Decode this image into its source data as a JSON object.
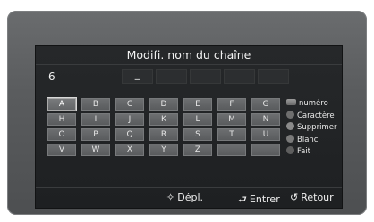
{
  "dialog": {
    "title": "Modifi. nom du chaîne",
    "channel_number": "6",
    "name_slots": [
      "_",
      "",
      "",
      "",
      ""
    ]
  },
  "keyboard": {
    "rows": [
      [
        "A",
        "B",
        "C",
        "D",
        "E",
        "F",
        "G"
      ],
      [
        "H",
        "I",
        "J",
        "K",
        "L",
        "M",
        "N"
      ],
      [
        "O",
        "P",
        "Q",
        "R",
        "S",
        "T",
        "U"
      ],
      [
        "V",
        "W",
        "X",
        "Y",
        "Z",
        "",
        ""
      ]
    ],
    "selected": "A"
  },
  "legend": [
    {
      "icon": "number-keys-icon",
      "label": "numéro",
      "color": "#8c8c8c"
    },
    {
      "icon": "red-button-icon",
      "label": "Caractère",
      "color": "#6e6e6e"
    },
    {
      "icon": "green-button-icon",
      "label": "Supprimer",
      "color": "#8a8a8a"
    },
    {
      "icon": "yellow-button-icon",
      "label": "Blanc",
      "color": "#7a7a7a"
    },
    {
      "icon": "blue-button-icon",
      "label": "Fait",
      "color": "#5e5e5e"
    }
  ],
  "footer": {
    "move_icon": "move-arrows-icon",
    "move_label": "Dépl.",
    "enter_icon": "enter-icon",
    "enter_label": "Entrer",
    "return_icon": "return-icon",
    "return_label": "Retour"
  }
}
